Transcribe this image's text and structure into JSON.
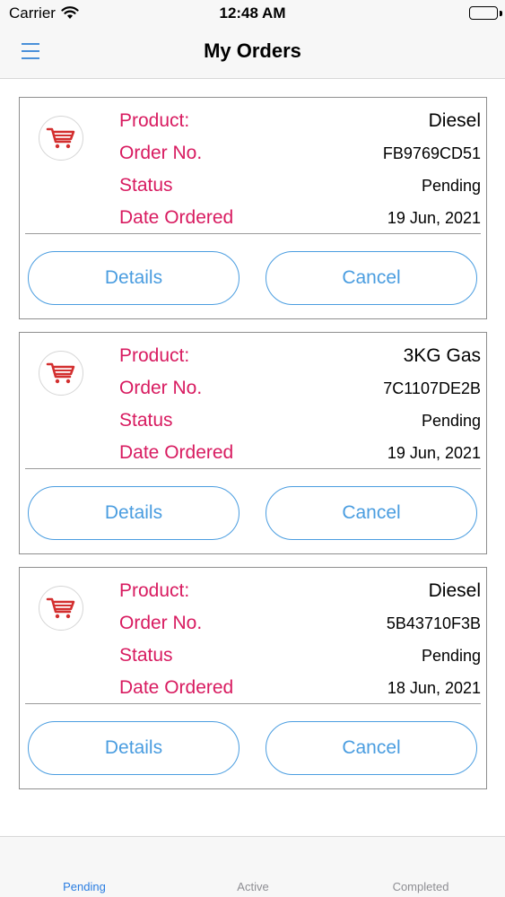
{
  "status_bar": {
    "carrier": "Carrier",
    "time": "12:48 AM"
  },
  "nav": {
    "title": "My Orders"
  },
  "colors": {
    "label": "#d81b60",
    "accent": "#4a9de0",
    "tab_active": "#2a7de1",
    "tab_inactive": "#8e8e93",
    "cart_icon": "#d32f2f"
  },
  "labels": {
    "product": "Product:",
    "order_no": "Order No.",
    "status": "Status",
    "date_ordered": "Date Ordered",
    "details_button": "Details",
    "cancel_button": "Cancel"
  },
  "orders": [
    {
      "product": "Diesel",
      "order_no": "FB9769CD51",
      "status": "Pending",
      "date": "19 Jun, 2021"
    },
    {
      "product": "3KG Gas",
      "order_no": "7C1107DE2B",
      "status": "Pending",
      "date": "19 Jun, 2021"
    },
    {
      "product": "Diesel",
      "order_no": "5B43710F3B",
      "status": "Pending",
      "date": "18 Jun, 2021"
    }
  ],
  "tabs": [
    {
      "label": "Pending",
      "active": true
    },
    {
      "label": "Active",
      "active": false
    },
    {
      "label": "Completed",
      "active": false
    }
  ]
}
